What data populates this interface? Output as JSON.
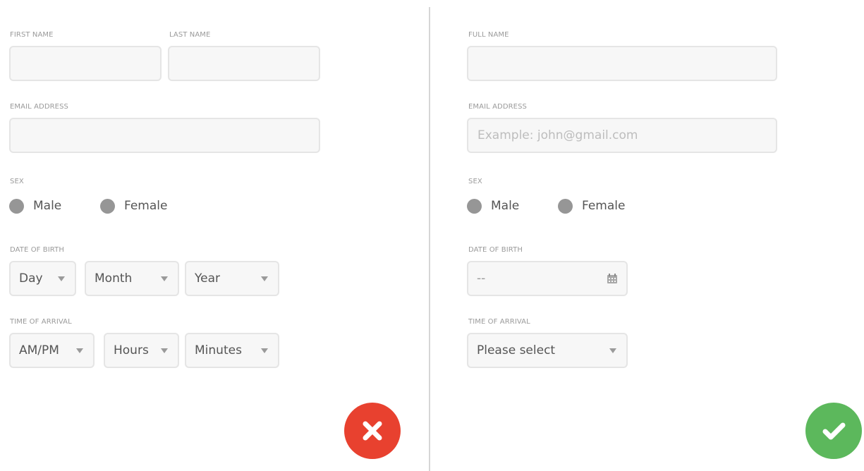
{
  "left_form": {
    "first_name_label": "FIRST NAME",
    "last_name_label": "LAST NAME",
    "email_label": "EMAIL ADDRESS",
    "sex_label": "SEX",
    "sex_options": [
      "Male",
      "Female"
    ],
    "dob_label": "DATE OF BIRTH",
    "dob_selects": [
      "Day",
      "Month",
      "Year"
    ],
    "arrival_label": "TIME OF ARRIVAL",
    "arrival_selects": [
      "AM/PM",
      "Hours",
      "Minutes"
    ],
    "action_icon": "close-icon",
    "action_color": "#e8412f"
  },
  "right_form": {
    "full_name_label": "FULL NAME",
    "email_label": "EMAIL ADDRESS",
    "email_placeholder": "Example: john@gmail.com",
    "sex_label": "SEX",
    "sex_options": [
      "Male",
      "Female"
    ],
    "dob_label": "DATE OF BIRTH",
    "dob_value": "--",
    "dob_icon": "calendar-icon",
    "arrival_label": "TIME OF ARRIVAL",
    "arrival_select": "Please select",
    "action_icon": "check-icon",
    "action_color": "#5cb85c"
  }
}
